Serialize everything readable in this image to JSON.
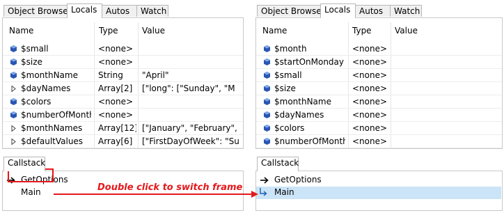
{
  "left_panel": {
    "tabs": [
      "Object Browser",
      "Locals",
      "Autos",
      "Watch"
    ],
    "active_tab": "Locals",
    "columns": [
      "Name",
      "Type",
      "Value"
    ],
    "rows": [
      {
        "expander": "none",
        "name": "$small",
        "type": "<none>",
        "value": ""
      },
      {
        "expander": "none",
        "name": "$size",
        "type": "<none>",
        "value": ""
      },
      {
        "expander": "none",
        "name": "$monthName",
        "type": "String",
        "value": "\"April\""
      },
      {
        "expander": "expand",
        "name": "$dayNames",
        "type": "Array[2]",
        "value": "[\"long\": [\"Sunday\", \"M"
      },
      {
        "expander": "none",
        "name": "$colors",
        "type": "<none>",
        "value": ""
      },
      {
        "expander": "none",
        "name": "$numberOfMonths",
        "type": "<none>",
        "value": ""
      },
      {
        "expander": "expand",
        "name": "$monthNames",
        "type": "Array[12]",
        "value": "[\"January\", \"February\","
      },
      {
        "expander": "expand",
        "name": "$defaultValues",
        "type": "Array[6]",
        "value": "[\"FirstDayOfWeek\": \"Su"
      }
    ]
  },
  "right_panel": {
    "tabs": [
      "Object Browser",
      "Locals",
      "Autos",
      "Watch"
    ],
    "active_tab": "Locals",
    "columns": [
      "Name",
      "Type",
      "Value"
    ],
    "rows": [
      {
        "expander": "none",
        "name": "$month",
        "type": "<none>",
        "value": ""
      },
      {
        "expander": "none",
        "name": "$startOnMonday",
        "type": "<none>",
        "value": ""
      },
      {
        "expander": "none",
        "name": "$small",
        "type": "<none>",
        "value": ""
      },
      {
        "expander": "none",
        "name": "$size",
        "type": "<none>",
        "value": ""
      },
      {
        "expander": "none",
        "name": "$monthName",
        "type": "<none>",
        "value": ""
      },
      {
        "expander": "none",
        "name": "$dayNames",
        "type": "<none>",
        "value": ""
      },
      {
        "expander": "none",
        "name": "$colors",
        "type": "<none>",
        "value": ""
      },
      {
        "expander": "none",
        "name": "$numberOfMonths",
        "type": "<none>",
        "value": ""
      }
    ]
  },
  "left_callstack": {
    "tab": "Callstack",
    "frames": [
      {
        "marker": "current",
        "label": "GetOptions"
      },
      {
        "marker": "none",
        "label": "Main"
      }
    ]
  },
  "right_callstack": {
    "tab": "Callstack",
    "frames": [
      {
        "marker": "current",
        "label": "GetOptions"
      },
      {
        "marker": "selected",
        "label": "Main"
      }
    ]
  },
  "annotation": {
    "text": "Double click to switch frame",
    "color": "#e4181c"
  },
  "colors": {
    "variable_icon": "#2a56b2",
    "selected_row": "#cce4f7"
  }
}
